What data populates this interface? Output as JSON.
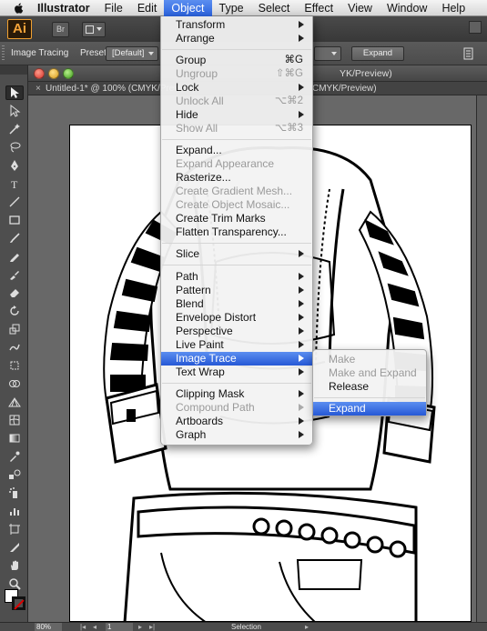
{
  "menubar": {
    "app_name": "Illustrator",
    "items": [
      "File",
      "Edit",
      "Object",
      "Type",
      "Select",
      "Effect",
      "View",
      "Window",
      "Help"
    ],
    "active": "Object"
  },
  "appbar": {
    "logo": "Ai",
    "bridge": "Br"
  },
  "control_bar": {
    "title": "Image Tracing",
    "preset_label": "Preset:",
    "preset_value": "[Default]",
    "expand_button": "Expand"
  },
  "window": {
    "title_right": "YK/Preview)",
    "tab_label": "Untitled-1* @ 100% (CMYK/Preview)",
    "tab_label_right": "CMYK/Preview)"
  },
  "object_menu": {
    "items": [
      {
        "label": "Transform",
        "submenu": true
      },
      {
        "label": "Arrange",
        "submenu": true
      },
      {
        "label": "Group",
        "shortcut": "⌘G"
      },
      {
        "label": "Ungroup",
        "shortcut": "⇧⌘G",
        "disabled": true
      },
      {
        "label": "Lock",
        "submenu": true
      },
      {
        "label": "Unlock All",
        "shortcut": "⌥⌘2",
        "disabled": true
      },
      {
        "label": "Hide",
        "submenu": true
      },
      {
        "label": "Show All",
        "shortcut": "⌥⌘3",
        "disabled": true
      },
      {
        "label": "Expand..."
      },
      {
        "label": "Expand Appearance",
        "disabled": true
      },
      {
        "label": "Rasterize..."
      },
      {
        "label": "Create Gradient Mesh...",
        "disabled": true
      },
      {
        "label": "Create Object Mosaic...",
        "disabled": true
      },
      {
        "label": "Create Trim Marks"
      },
      {
        "label": "Flatten Transparency..."
      },
      {
        "label": "Slice",
        "submenu": true
      },
      {
        "label": "Path",
        "submenu": true
      },
      {
        "label": "Pattern",
        "submenu": true
      },
      {
        "label": "Blend",
        "submenu": true
      },
      {
        "label": "Envelope Distort",
        "submenu": true
      },
      {
        "label": "Perspective",
        "submenu": true
      },
      {
        "label": "Live Paint",
        "submenu": true
      },
      {
        "label": "Image Trace",
        "submenu": true,
        "highlighted": true
      },
      {
        "label": "Text Wrap",
        "submenu": true
      },
      {
        "label": "Clipping Mask",
        "submenu": true
      },
      {
        "label": "Compound Path",
        "submenu": true,
        "disabled": true
      },
      {
        "label": "Artboards",
        "submenu": true
      },
      {
        "label": "Graph",
        "submenu": true
      }
    ]
  },
  "image_trace_submenu": {
    "items": [
      {
        "label": "Make",
        "disabled": true
      },
      {
        "label": "Make and Expand",
        "disabled": true
      },
      {
        "label": "Release"
      },
      {
        "label": "Expand",
        "highlighted": true
      }
    ]
  },
  "status_bar": {
    "zoom": "80%",
    "page": "1",
    "tool": "Selection"
  },
  "colors": {
    "menu_highlight": "#2a62de",
    "ui_dark": "#535353",
    "canvas_bg": "#686868"
  }
}
